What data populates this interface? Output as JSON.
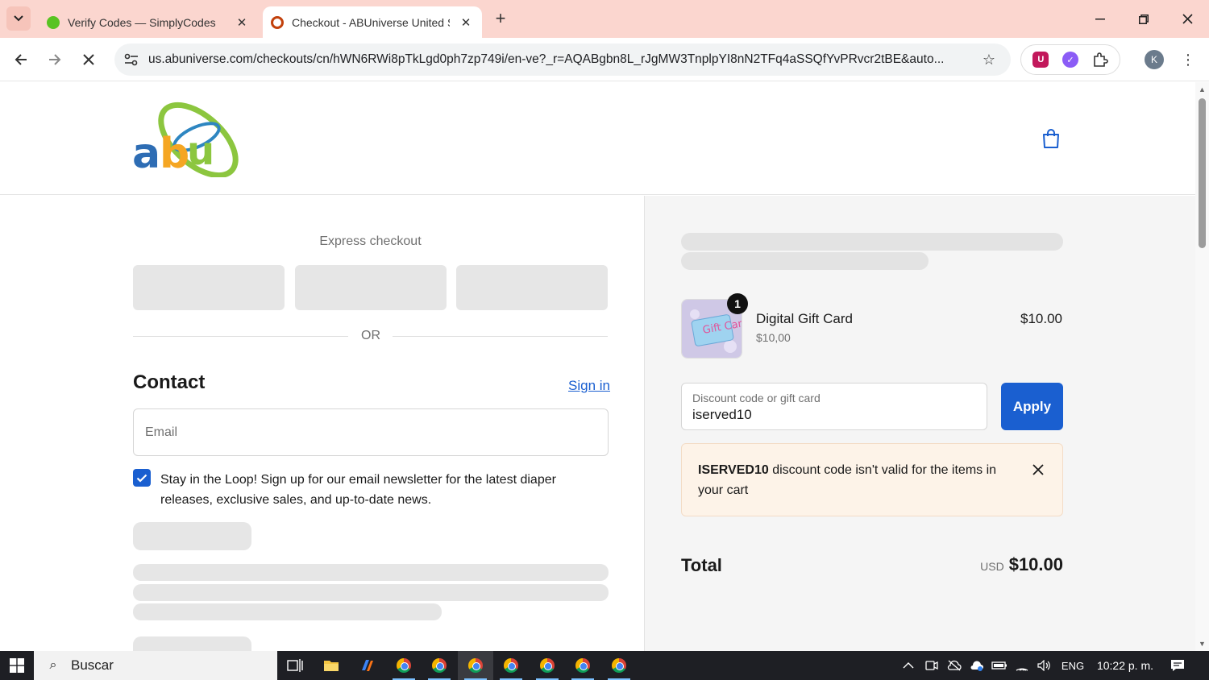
{
  "browser": {
    "tabs": [
      {
        "title": "Verify Codes — SimplyCodes",
        "active": false,
        "favicon_color": "#58c322"
      },
      {
        "title": "Checkout - ABUniverse United S",
        "active": true,
        "favicon_color": "#c2410c"
      }
    ],
    "url": "us.abuniverse.com/checkouts/cn/hWN6RWi8pTkLgd0ph7zp749i/en-ve?_r=AQABgbn8L_rJgMW3TnplpYI8nN2TFq4aSSQfYvPRvcr2tBE&auto...",
    "profile_initial": "K"
  },
  "page": {
    "logo_text": "abu",
    "express_checkout_label": "Express checkout",
    "or_label": "OR",
    "contact_heading": "Contact",
    "sign_in_label": "Sign in",
    "email_placeholder": "Email",
    "newsletter_label": "Stay in the Loop! Sign up for our email newsletter for the latest diaper releases, exclusive sales, and up-to-date news.",
    "newsletter_checked": true
  },
  "summary": {
    "item": {
      "name": "Digital Gift Card",
      "variant": "$10,00",
      "price": "$10.00",
      "quantity": "1",
      "image_text": "Gift Card"
    },
    "discount": {
      "label": "Discount code or gift card",
      "value": "iserved10",
      "apply_label": "Apply"
    },
    "alert": {
      "code": "ISERVED10",
      "message": " discount code isn't valid for the items in your cart"
    },
    "total": {
      "label": "Total",
      "currency": "USD",
      "amount": "$10.00"
    }
  },
  "taskbar": {
    "search_placeholder": "Buscar",
    "language": "ENG",
    "time": "10:22 p. m."
  },
  "colors": {
    "accent": "#1a5fd0",
    "tabbar": "#fbd6cf",
    "alert_bg": "#fdf3e8"
  }
}
